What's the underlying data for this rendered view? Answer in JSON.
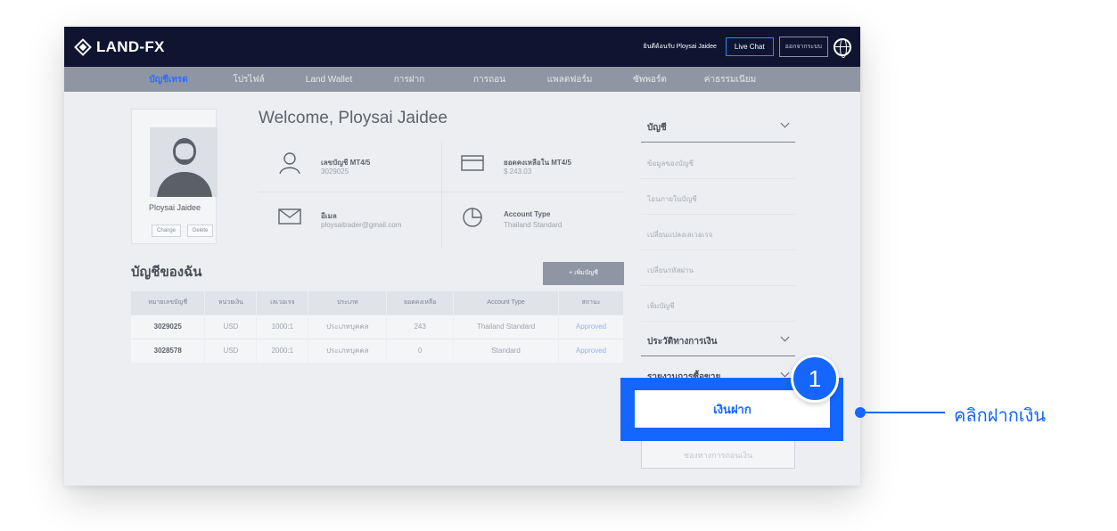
{
  "header": {
    "logo": "LAND-FX",
    "welcome_small": "ยินดีต้อนรับ Ploysai Jaidee",
    "live_chat": "Live Chat",
    "logout": "ออกจากระบบ"
  },
  "nav": [
    {
      "label": "บัญชีเทรด",
      "active": true
    },
    {
      "label": "โปรไฟล์",
      "active": false
    },
    {
      "label": "Land Wallet",
      "active": false
    },
    {
      "label": "การฝาก",
      "active": false
    },
    {
      "label": "การถอน",
      "active": false
    },
    {
      "label": "แพลตฟอร์ม",
      "active": false
    },
    {
      "label": "ซัพพอร์ต",
      "active": false
    },
    {
      "label": "ค่าธรรมเนียม",
      "active": false
    }
  ],
  "profile": {
    "name": "Ploysai Jaidee",
    "change": "Change",
    "delete": "Delete"
  },
  "welcome_title": "Welcome, Ploysai Jaidee",
  "info": {
    "account_label": "เลขบัญชี MT4/5",
    "account_value": "3029025",
    "balance_label": "ยอดคงเหลือใน MT4/5",
    "balance_value": "$ 243.03",
    "email_label": "อีเมล",
    "email_value": "ploysaitrader@gmail.com",
    "type_label": "Account Type",
    "type_value": "Thailand Standard"
  },
  "accounts": {
    "title": "บัญชีของฉัน",
    "add_button": "+ เพิ่มบัญชี",
    "headers": [
      "หมายเลขบัญชี",
      "หน่วยเงิน",
      "เลเวอเรจ",
      "ประเภท",
      "ยอดคงเหลือ",
      "Account Type",
      "สถานะ"
    ],
    "rows": [
      [
        "3029025",
        "USD",
        "1000:1",
        "ประเภทบุคคล",
        "243",
        "Thailand Standard",
        "Approved"
      ],
      [
        "3028578",
        "USD",
        "2000:1",
        "ประเภทบุคคล",
        "0",
        "Standard",
        "Approved"
      ]
    ]
  },
  "sidebar": {
    "section1": "บัญชี",
    "items": [
      "ข้อมูลของบัญชี",
      "โอนภายในบัญชี",
      "เปลี่ยนแปลงเลเวอเรจ",
      "เปลี่ยนรหัสผ่าน",
      "เพิ่มบัญชี"
    ],
    "section2": "ประวัติทางการเงิน",
    "section3": "รายงานการซื้อขาย",
    "withdraw": "ช่องทางการถอนเงิน"
  },
  "highlight": {
    "deposit": "เงินฝาก",
    "step": "1",
    "callout": "คลิกฝากเงิน",
    "accent": "#1466ff"
  }
}
